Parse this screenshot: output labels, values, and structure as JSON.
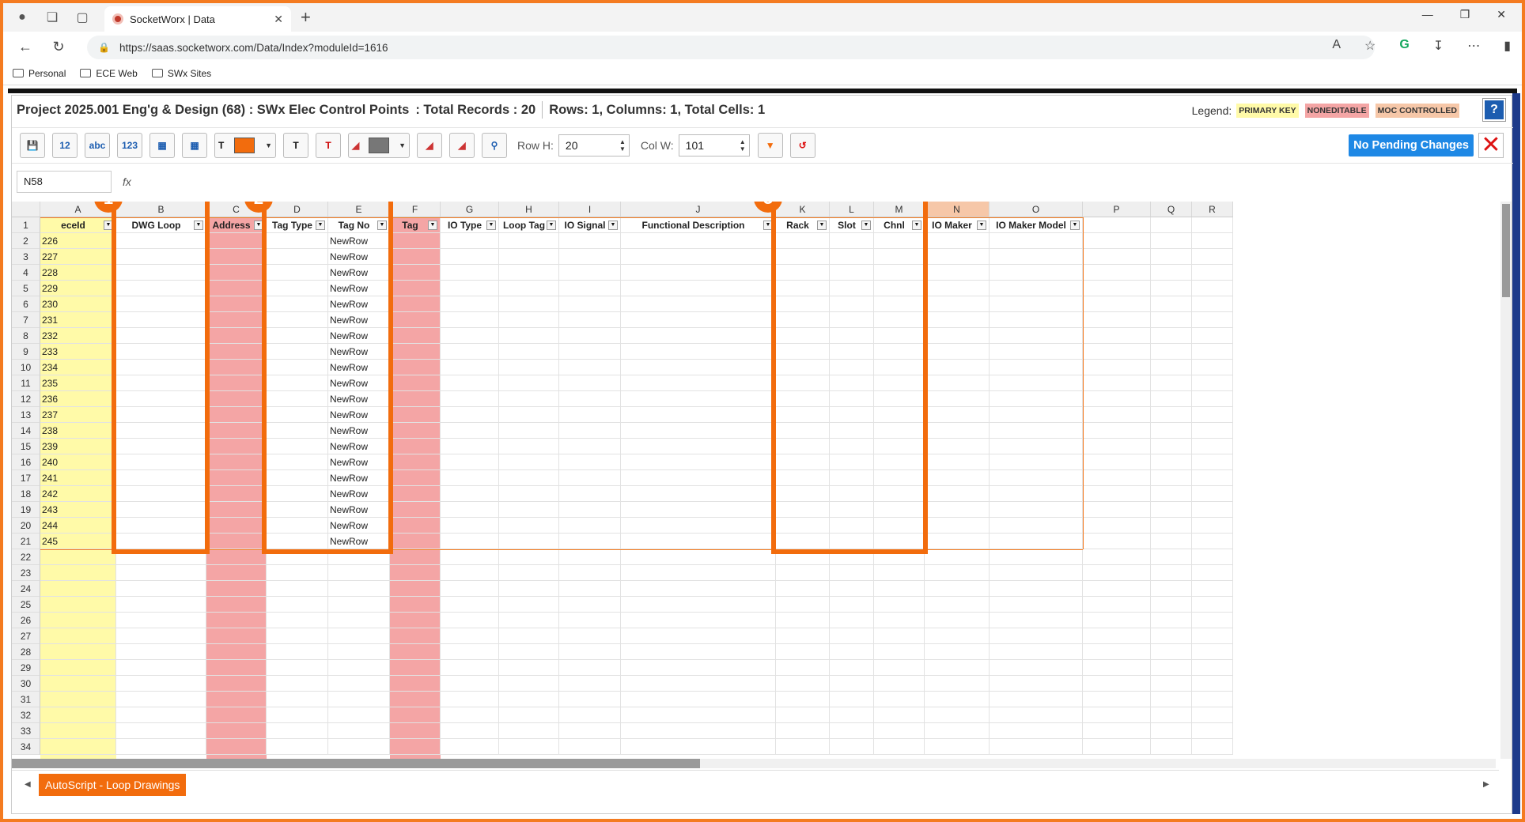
{
  "browser": {
    "tab_title": "SocketWorx | Data",
    "url": "https://saas.socketworx.com/Data/Index?moduleId=1616",
    "bookmarks": [
      "Personal",
      "ECE Web",
      "SWx Sites"
    ]
  },
  "app": {
    "title_parts": [
      "Project 2025.001 Eng'g & Design (68) : SWx Elec Control Points",
      ": Total Records : 20",
      "Rows: 1, Columns: 1, Total Cells: 1"
    ],
    "legend_label": "Legend:",
    "legend": [
      {
        "label": "PRIMARY KEY",
        "color": "#fffaa8"
      },
      {
        "label": "NONEDITABLE",
        "color": "#f4a5a5"
      },
      {
        "label": "MOC CONTROLLED",
        "color": "#f6c7a8"
      }
    ],
    "help_label": "?",
    "toolbar": {
      "row_h_label": "Row H:",
      "row_h_value": "20",
      "col_w_label": "Col W:",
      "col_w_value": "101",
      "pending_label": "No Pending Changes",
      "text_color": "#f26c0d"
    },
    "cell_ref": "N58",
    "fx_label": "fx",
    "sheet_tab": "AutoScript - Loop Drawings"
  },
  "grid": {
    "column_letters": [
      "A",
      "B",
      "C",
      "D",
      "E",
      "F",
      "G",
      "H",
      "I",
      "J",
      "K",
      "L",
      "M",
      "N",
      "O",
      "P",
      "Q",
      "R"
    ],
    "header_row": [
      "eceId",
      "DWG Loop",
      "Address",
      "Tag Type",
      "Tag No",
      "Tag",
      "IO Type",
      "Loop Tag",
      "IO Signal",
      "Functional Description",
      "Rack",
      "Slot",
      "Chnl",
      "IO Maker",
      "IO Maker Model",
      "",
      "",
      ""
    ],
    "row_numbers": [
      "1",
      "2",
      "3",
      "4",
      "5",
      "6",
      "7",
      "8",
      "9",
      "10",
      "11",
      "12",
      "13",
      "14",
      "15",
      "16",
      "17",
      "18",
      "19",
      "20",
      "21",
      "22",
      "23",
      "24",
      "25",
      "26",
      "27",
      "28",
      "29",
      "30",
      "31",
      "32",
      "33",
      "34"
    ],
    "ece_ids": [
      "226",
      "227",
      "228",
      "229",
      "230",
      "231",
      "232",
      "233",
      "234",
      "235",
      "236",
      "237",
      "238",
      "239",
      "240",
      "241",
      "242",
      "243",
      "244",
      "245"
    ],
    "tag_no_value": "NewRow",
    "callouts": [
      "1",
      "2",
      "3"
    ],
    "selected_column": "N"
  }
}
